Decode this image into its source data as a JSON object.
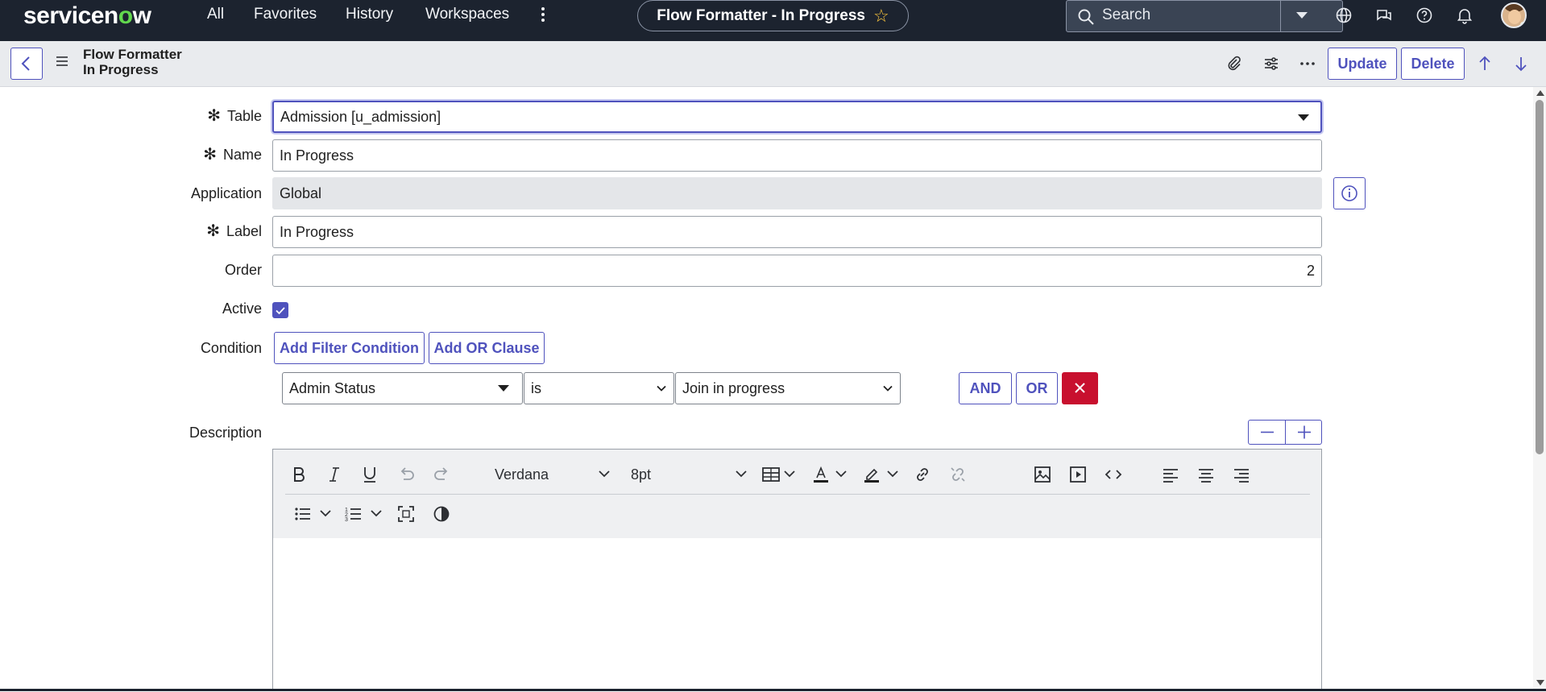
{
  "topnav": {
    "logo_main": "servicen",
    "logo_o": "o",
    "logo_tail": "w",
    "links": [
      "All",
      "Favorites",
      "History",
      "Workspaces"
    ],
    "context_title": "Flow Formatter - In Progress",
    "search_placeholder": "Search"
  },
  "header": {
    "title_line1": "Flow Formatter",
    "title_line2": "In Progress",
    "update_label": "Update",
    "delete_label": "Delete"
  },
  "form": {
    "table_label": "Table",
    "table_value": "Admission [u_admission]",
    "name_label": "Name",
    "name_value": "In Progress",
    "application_label": "Application",
    "application_value": "Global",
    "label_label": "Label",
    "label_value": "In Progress",
    "order_label": "Order",
    "order_value": "2",
    "active_label": "Active",
    "active_checked": true,
    "condition_label": "Condition",
    "add_filter_label": "Add Filter Condition",
    "add_or_label": "Add OR Clause",
    "condition": {
      "field": "Admin Status",
      "operator": "is",
      "value": "Join in progress",
      "and_label": "AND",
      "or_label": "OR"
    },
    "description_label": "Description"
  },
  "editor": {
    "font_name": "Verdana",
    "font_size": "8pt"
  },
  "colors": {
    "accent": "#4f52bd",
    "nav_bg": "#1c232f",
    "danger": "#c8102e",
    "logo_green": "#62d84e"
  }
}
